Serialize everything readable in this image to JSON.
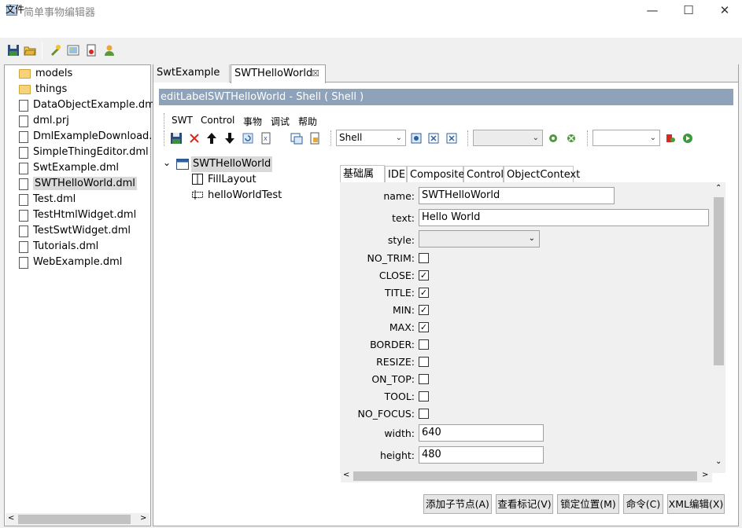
{
  "window": {
    "title": "简单事物编辑器",
    "minimize": "—",
    "maximize": "☐",
    "close": "✕"
  },
  "menubar": {
    "file": "文件"
  },
  "toolbar_icons": [
    "save-icon",
    "open-icon",
    "run-icon",
    "image-icon",
    "document-icon",
    "user-icon"
  ],
  "file_tree": {
    "items": [
      {
        "label": "models",
        "type": "folder"
      },
      {
        "label": "things",
        "type": "folder"
      },
      {
        "label": "DataObjectExample.dml",
        "type": "file"
      },
      {
        "label": "dml.prj",
        "type": "file"
      },
      {
        "label": "DmlExampleDownload.c",
        "type": "file"
      },
      {
        "label": "SimpleThingEditor.dml",
        "type": "file"
      },
      {
        "label": "SwtExample.dml",
        "type": "file"
      },
      {
        "label": "SWTHelloWorld.dml",
        "type": "file",
        "selected": true
      },
      {
        "label": "Test.dml",
        "type": "file"
      },
      {
        "label": "TestHtmlWidget.dml",
        "type": "file"
      },
      {
        "label": "TestSwtWidget.dml",
        "type": "file"
      },
      {
        "label": "Tutorials.dml",
        "type": "file"
      },
      {
        "label": "WebExample.dml",
        "type": "file"
      }
    ]
  },
  "tabs": [
    {
      "label": "SwtExample"
    },
    {
      "label": "SWTHelloWorld",
      "active": true,
      "close": "☒"
    }
  ],
  "editor": {
    "header": "editLabelSWTHelloWorld - Shell ( Shell )",
    "menu": [
      "SWT",
      "Control",
      "事物",
      "调试",
      "帮助"
    ],
    "type_combo": "Shell",
    "combo2": "",
    "combo3": ""
  },
  "tree": {
    "root": "SWTHelloWorld",
    "expander": "⌄",
    "children": [
      "FillLayout",
      "helloWorldTest"
    ]
  },
  "prop_tabs": [
    "基础属性",
    "IDE",
    "Composite",
    "Control",
    "ObjectContext"
  ],
  "properties": {
    "name_label": "name:",
    "name_value": "SWTHelloWorld",
    "text_label": "text:",
    "text_value": "Hello World",
    "style_label": "style:",
    "style_value": "",
    "checks": [
      {
        "label": "NO_TRIM:",
        "checked": false
      },
      {
        "label": "CLOSE:",
        "checked": true
      },
      {
        "label": "TITLE:",
        "checked": true
      },
      {
        "label": "MIN:",
        "checked": true
      },
      {
        "label": "MAX:",
        "checked": true
      },
      {
        "label": "BORDER:",
        "checked": false
      },
      {
        "label": "RESIZE:",
        "checked": false
      },
      {
        "label": "ON_TOP:",
        "checked": false
      },
      {
        "label": "TOOL:",
        "checked": false
      },
      {
        "label": "NO_FOCUS:",
        "checked": false
      }
    ],
    "width_label": "width:",
    "width_value": "640",
    "height_label": "height:",
    "height_value": "480"
  },
  "buttons": {
    "add_child": "添加子节点(A)",
    "view_marks": "查看标记(V)",
    "lock_position": "锁定位置(M)",
    "command": "命令(C)",
    "xml_edit": "XML编辑(X)"
  },
  "colors": {
    "header_bar": "#8ea3b9",
    "selected_bg": "#d9d9d9",
    "delete_red": "#d9281d"
  }
}
